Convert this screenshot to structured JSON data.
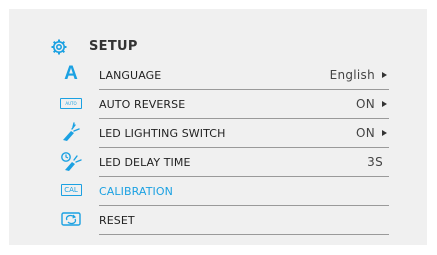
{
  "accent": "#1ba1e2",
  "setup": {
    "title": "SETUP",
    "icon": "gear-icon"
  },
  "menu": [
    {
      "label": "LANGUAGE",
      "value": "English",
      "icon": "letter-a-icon",
      "arrow": true
    },
    {
      "label": "AUTO REVERSE",
      "value": "ON",
      "icon": "auto-reverse-icon",
      "icon_text": "AUTO REV",
      "arrow": true
    },
    {
      "label": "LED LIGHTING SWITCH",
      "value": "ON",
      "icon": "light-switch-icon",
      "arrow": true
    },
    {
      "label": "LED DELAY TIME",
      "value": "3S",
      "icon": "clock-light-icon",
      "arrow": false
    },
    {
      "label": "CALIBRATION",
      "value": "",
      "icon": "cal-icon",
      "icon_text": "CAL",
      "arrow": false,
      "active": true
    },
    {
      "label": "RESET",
      "value": "",
      "icon": "reset-icon",
      "arrow": false
    }
  ]
}
